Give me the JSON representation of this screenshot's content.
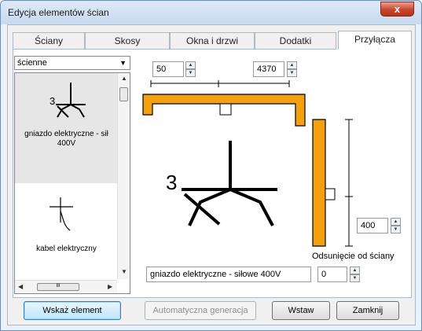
{
  "window": {
    "title": "Edycja elementów ścian",
    "close_label": "x"
  },
  "tabs": [
    {
      "label": "Ściany"
    },
    {
      "label": "Skosy"
    },
    {
      "label": "Okna i drzwi"
    },
    {
      "label": "Dodatki"
    },
    {
      "label": "Przyłącza",
      "active": true
    }
  ],
  "category_select": {
    "value": "ścienne"
  },
  "element_list": {
    "items": [
      {
        "label": "gniazdo elektryczne - sił 400V",
        "icon": "socket-symbol-icon",
        "selected": true
      },
      {
        "label": "kabel elektryczny",
        "icon": "cable-symbol-icon",
        "selected": false
      }
    ],
    "hscroll_thumb": "III"
  },
  "dimensions": {
    "left_value": "50",
    "width_value": "4370",
    "height_value": "400",
    "offset_label": "Odsunięcie od ściany",
    "offset_value": "0"
  },
  "element_name": "gniazdo elektryczne - siłowe 400V",
  "symbol_text": "3",
  "buttons": {
    "select_element": "Wskaż element",
    "auto_generate": "Automatyczna generacja",
    "insert": "Wstaw",
    "close": "Zamknij"
  },
  "colors": {
    "wall": "#f5a10f",
    "wall_border": "#000000"
  }
}
